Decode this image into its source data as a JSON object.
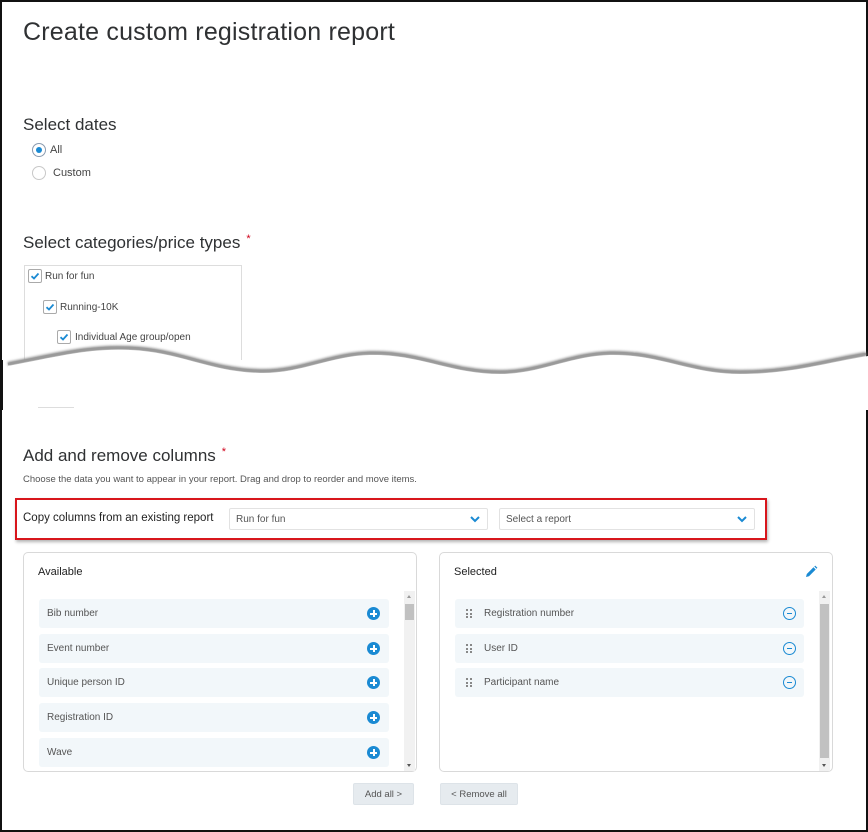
{
  "page": {
    "title": "Create custom registration report"
  },
  "dates": {
    "heading": "Select dates",
    "options": [
      {
        "label": "All",
        "selected": true
      },
      {
        "label": "Custom",
        "selected": false
      }
    ]
  },
  "categories": {
    "heading": "Select categories/price types",
    "required_mark": "*",
    "items": [
      {
        "label": "Run for fun",
        "checked": true,
        "level": 0
      },
      {
        "label": "Running-10K",
        "checked": true,
        "level": 1
      },
      {
        "label": "Individual Age group/open",
        "checked": true,
        "level": 2
      }
    ]
  },
  "columns": {
    "heading": "Add and remove columns",
    "required_mark": "*",
    "description": "Choose the data you want to appear in your report. Drag and drop to reorder and move items.",
    "copy": {
      "label": "Copy columns from an existing report",
      "category_select": {
        "value": "Run for fun"
      },
      "report_select": {
        "placeholder": "Select a report"
      },
      "highlight_color": "#d8161c"
    },
    "available": {
      "title": "Available",
      "items": [
        "Bib number",
        "Event number",
        "Unique person ID",
        "Registration ID",
        "Wave"
      ]
    },
    "selected": {
      "title": "Selected",
      "items": [
        "Registration number",
        "User ID",
        "Participant name"
      ]
    },
    "add_all_label": "Add all >",
    "remove_all_label": "< Remove all"
  },
  "colors": {
    "accent": "#1a8ad3",
    "item_bg": "#f2f7fa"
  }
}
